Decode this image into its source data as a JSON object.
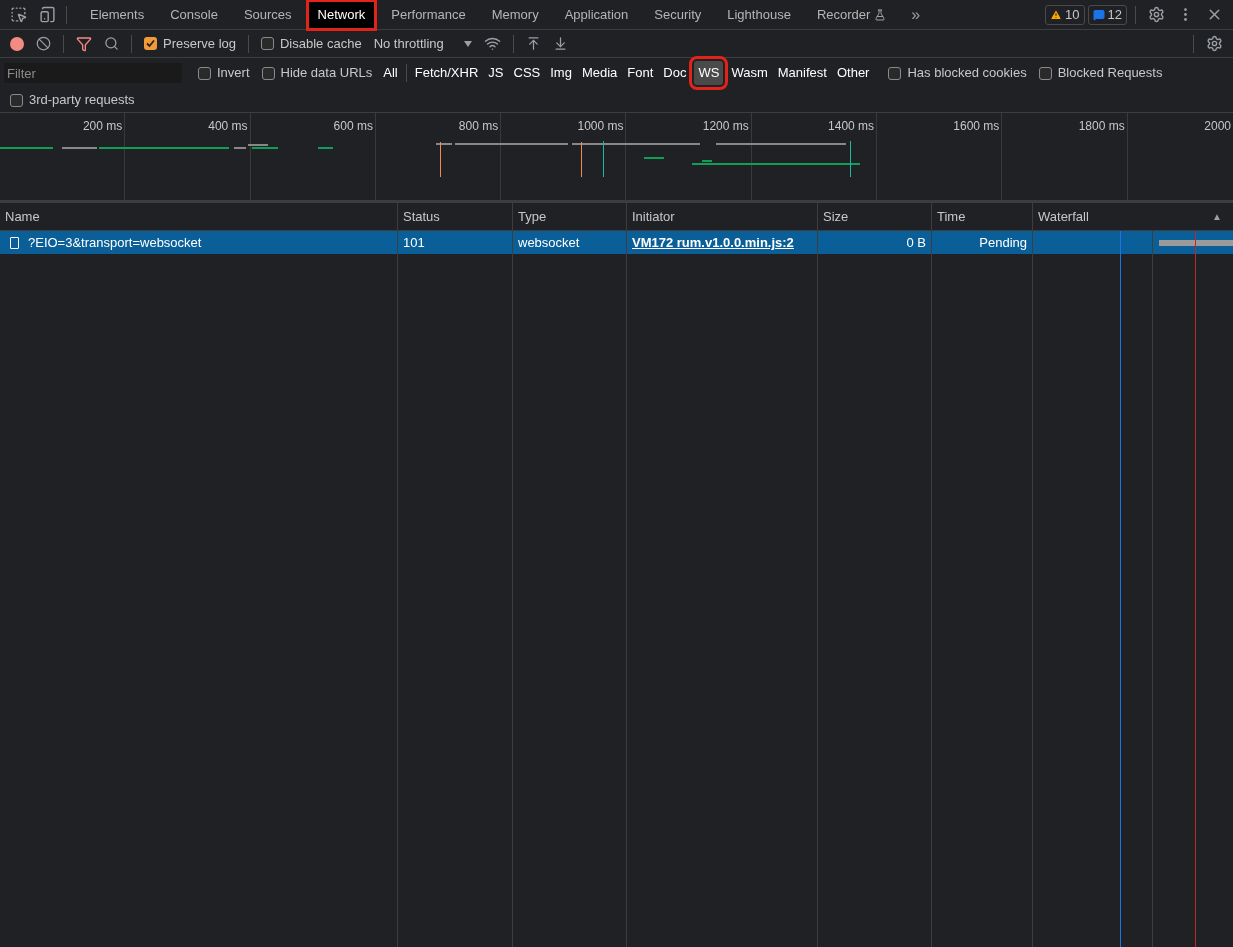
{
  "tabs": [
    {
      "label": "Elements",
      "selected": false
    },
    {
      "label": "Console",
      "selected": false
    },
    {
      "label": "Sources",
      "selected": false
    },
    {
      "label": "Network",
      "selected": true
    },
    {
      "label": "Performance",
      "selected": false
    },
    {
      "label": "Memory",
      "selected": false
    },
    {
      "label": "Application",
      "selected": false
    },
    {
      "label": "Security",
      "selected": false
    },
    {
      "label": "Lighthouse",
      "selected": false
    },
    {
      "label": "Recorder",
      "selected": false,
      "experimental": true
    }
  ],
  "more_tabs": "»",
  "warnings": "10",
  "messages": "12",
  "toolbar": {
    "preserve_log": {
      "label": "Preserve log",
      "checked": true
    },
    "disable_cache": {
      "label": "Disable cache",
      "checked": false
    },
    "throttling": "No throttling"
  },
  "filter": {
    "placeholder": "Filter",
    "invert": {
      "label": "Invert",
      "checked": false
    },
    "hide_data_urls": {
      "label": "Hide data URLs",
      "checked": false
    },
    "types": [
      {
        "label": "All",
        "selected": false
      },
      {
        "label": "Fetch/XHR",
        "selected": false
      },
      {
        "label": "JS",
        "selected": false
      },
      {
        "label": "CSS",
        "selected": false
      },
      {
        "label": "Img",
        "selected": false
      },
      {
        "label": "Media",
        "selected": false
      },
      {
        "label": "Font",
        "selected": false
      },
      {
        "label": "Doc",
        "selected": false
      },
      {
        "label": "WS",
        "selected": true
      },
      {
        "label": "Wasm",
        "selected": false
      },
      {
        "label": "Manifest",
        "selected": false
      },
      {
        "label": "Other",
        "selected": false
      }
    ],
    "has_blocked_cookies": {
      "label": "Has blocked cookies",
      "checked": false
    },
    "blocked_requests": {
      "label": "Blocked Requests",
      "checked": false
    },
    "third_party": {
      "label": "3rd-party requests",
      "checked": false
    }
  },
  "overview": {
    "ticks": [
      "200 ms",
      "400 ms",
      "600 ms",
      "800 ms",
      "1000 ms",
      "1200 ms",
      "1400 ms",
      "1600 ms",
      "1800 ms",
      "2000"
    ]
  },
  "table": {
    "columns": [
      "Name",
      "Status",
      "Type",
      "Initiator",
      "Size",
      "Time",
      "Waterfall"
    ],
    "sort_indicator": "▲",
    "rows": [
      {
        "name": "?EIO=3&transport=websocket",
        "status": "101",
        "type": "websocket",
        "initiator": "VM172 rum.v1.0.0.min.js:2",
        "size": "0 B",
        "time": "Pending",
        "selected": true
      }
    ]
  }
}
